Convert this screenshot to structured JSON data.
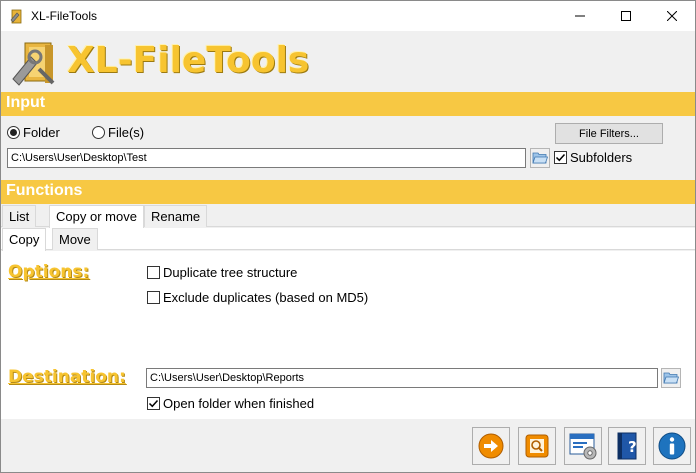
{
  "window": {
    "title": "XL-FileTools"
  },
  "logo": {
    "text": "XL-FileTools"
  },
  "sections": {
    "input": "Input",
    "functions": "Functions"
  },
  "input": {
    "mode_folder": "Folder",
    "mode_files": "File(s)",
    "selected_mode": "folder",
    "file_filters_label": "File Filters...",
    "path_value": "C:\\Users\\User\\Desktop\\Test",
    "subfolders_label": "Subfolders",
    "subfolders_checked": true
  },
  "tabs": {
    "outer": [
      "List",
      "Copy or move",
      "Rename"
    ],
    "outer_active": "Copy or move",
    "inner": [
      "Copy",
      "Move"
    ],
    "inner_active": "Copy"
  },
  "copy": {
    "options_heading": "Options:",
    "duplicate_tree_label": "Duplicate tree structure",
    "duplicate_tree_checked": false,
    "exclude_duplicates_label": "Exclude duplicates (based on MD5)",
    "exclude_duplicates_checked": false,
    "destination_heading": "Destination:",
    "destination_value": "C:\\Users\\User\\Desktop\\Reports",
    "open_folder_label": "Open folder when finished",
    "open_folder_checked": true
  },
  "toolbar": {
    "icons": [
      "run-arrow-icon",
      "preview-search-icon",
      "settings-window-icon",
      "help-book-icon",
      "info-icon"
    ]
  },
  "colors": {
    "accent": "#f7c843",
    "logo": "#f7c430",
    "info_blue": "#1e73be",
    "run_orange": "#f08c00"
  }
}
